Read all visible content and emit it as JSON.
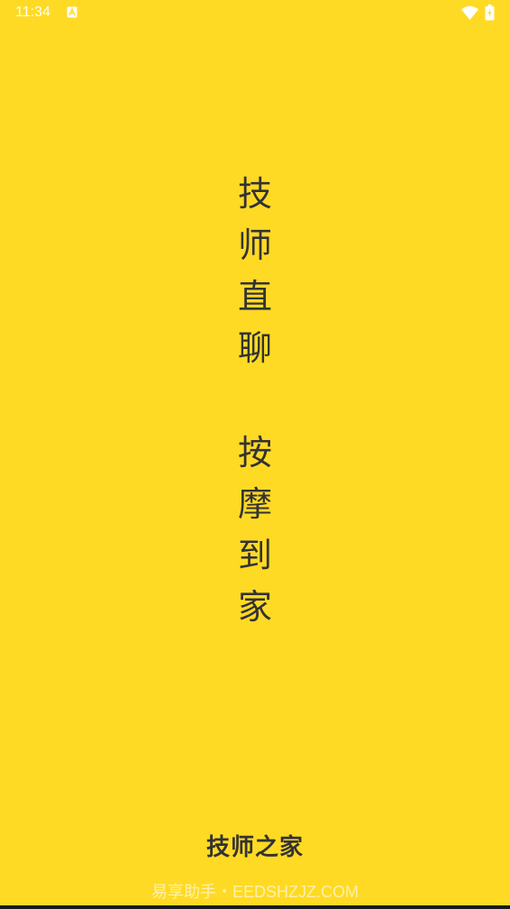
{
  "status_bar": {
    "time": "11:34",
    "icons": [
      "notification-a-icon",
      "wifi-icon",
      "battery-charging-icon"
    ]
  },
  "splash": {
    "column1": [
      "技",
      "师",
      "直",
      "聊"
    ],
    "column2": [
      "按",
      "摩",
      "到",
      "家"
    ]
  },
  "app_name": "技师之家",
  "watermark": "易享助手・EEDSHZJZ.COM",
  "colors": {
    "background": "#FFDA24",
    "text": "#333333",
    "status_text": "#ffffff"
  }
}
